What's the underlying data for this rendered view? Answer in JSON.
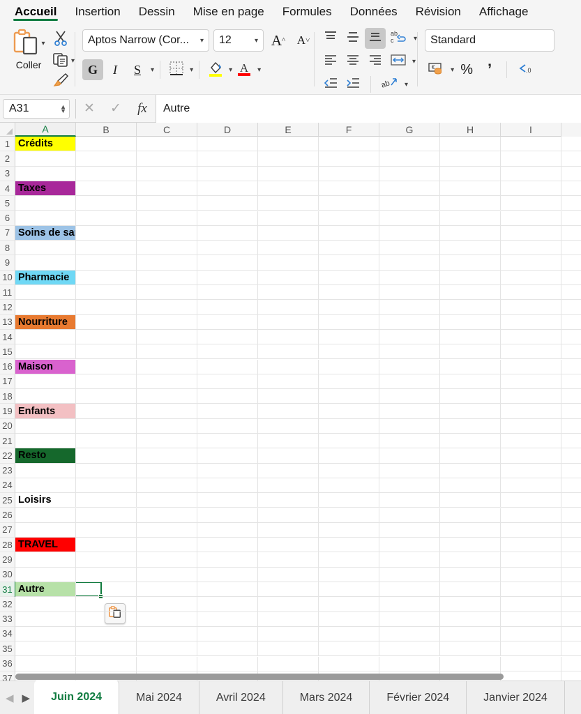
{
  "ribbon": {
    "tabs": [
      {
        "label": "Accueil",
        "active": true
      },
      {
        "label": "Insertion",
        "active": false
      },
      {
        "label": "Dessin",
        "active": false
      },
      {
        "label": "Mise en page",
        "active": false
      },
      {
        "label": "Formules",
        "active": false
      },
      {
        "label": "Données",
        "active": false
      },
      {
        "label": "Révision",
        "active": false
      },
      {
        "label": "Affichage",
        "active": false
      }
    ],
    "clipboard": {
      "paste_label": "Coller",
      "paste_icon": "clipboard-icon",
      "cut_icon": "scissors-icon",
      "copy_icon": "copy-icon",
      "format_painter_icon": "format-painter-icon"
    },
    "font": {
      "name": "Aptos Narrow (Cor...",
      "size": "12",
      "grow_label": "A",
      "shrink_label": "A",
      "bold_label": "G",
      "italic_label": "I",
      "underline_label": "S",
      "borders_icon": "borders-icon",
      "fill_color_icon": "fill-color-icon",
      "font_color_icon": "font-color-icon",
      "fill_color": "#FFFF00",
      "font_color": "#FF0000"
    },
    "alignment": {
      "align_top_icon": "align-top-icon",
      "align_middle_icon": "align-middle-icon",
      "align_bottom_icon": "align-bottom-icon",
      "wrap_text_icon": "wrap-text-icon",
      "align_left_icon": "align-left-icon",
      "align_center_icon": "align-center-icon",
      "align_right_icon": "align-right-icon",
      "merge_cells_icon": "merge-cells-icon",
      "decrease_indent_icon": "decrease-indent-icon",
      "increase_indent_icon": "increase-indent-icon",
      "orientation_icon": "text-orientation-icon"
    },
    "number": {
      "format": "Standard",
      "currency_icon": "currency-icon",
      "percent_label": "%",
      "comma_label": "’",
      "decimal_icon": "decrease-decimal-icon"
    },
    "accent_color": "#107c41"
  },
  "formula_bar": {
    "name_box": "A31",
    "cancel_icon": "cancel-icon",
    "confirm_icon": "confirm-icon",
    "fx_label": "fx",
    "content": "Autre"
  },
  "grid": {
    "columns": [
      "A",
      "B",
      "C",
      "D",
      "E",
      "F",
      "G",
      "H",
      "I"
    ],
    "selected_column": "A",
    "selected_cell": "A31",
    "row_count": 37,
    "rows": [
      {
        "n": 1,
        "value": "Crédits",
        "fill": "#FFFF00"
      },
      {
        "n": 2,
        "value": "",
        "fill": ""
      },
      {
        "n": 3,
        "value": "",
        "fill": ""
      },
      {
        "n": 4,
        "value": "Taxes",
        "fill": "#A8289A"
      },
      {
        "n": 5,
        "value": "",
        "fill": ""
      },
      {
        "n": 6,
        "value": "",
        "fill": ""
      },
      {
        "n": 7,
        "value": "Soins de santé",
        "fill": "#9DC3E6"
      },
      {
        "n": 8,
        "value": "",
        "fill": ""
      },
      {
        "n": 9,
        "value": "",
        "fill": ""
      },
      {
        "n": 10,
        "value": "Pharmacie",
        "fill": "#6FD8F5"
      },
      {
        "n": 11,
        "value": "",
        "fill": ""
      },
      {
        "n": 12,
        "value": "",
        "fill": ""
      },
      {
        "n": 13,
        "value": "Nourriture",
        "fill": "#E87A30"
      },
      {
        "n": 14,
        "value": "",
        "fill": ""
      },
      {
        "n": 15,
        "value": "",
        "fill": ""
      },
      {
        "n": 16,
        "value": "Maison",
        "fill": "#D962CE"
      },
      {
        "n": 17,
        "value": "",
        "fill": ""
      },
      {
        "n": 18,
        "value": "",
        "fill": ""
      },
      {
        "n": 19,
        "value": "Enfants",
        "fill": "#F3C0C3"
      },
      {
        "n": 20,
        "value": "",
        "fill": ""
      },
      {
        "n": 21,
        "value": "",
        "fill": ""
      },
      {
        "n": 22,
        "value": "Resto",
        "fill": "#15682C"
      },
      {
        "n": 23,
        "value": "",
        "fill": ""
      },
      {
        "n": 24,
        "value": "",
        "fill": ""
      },
      {
        "n": 25,
        "value": "Loisirs",
        "fill": ""
      },
      {
        "n": 26,
        "value": "",
        "fill": ""
      },
      {
        "n": 27,
        "value": "",
        "fill": ""
      },
      {
        "n": 28,
        "value": "TRAVEL",
        "fill": "#FF0000"
      },
      {
        "n": 29,
        "value": "",
        "fill": ""
      },
      {
        "n": 30,
        "value": "",
        "fill": ""
      },
      {
        "n": 31,
        "value": "Autre",
        "fill": "#B7E1A8"
      },
      {
        "n": 32,
        "value": "",
        "fill": ""
      },
      {
        "n": 33,
        "value": "",
        "fill": ""
      },
      {
        "n": 34,
        "value": "",
        "fill": ""
      },
      {
        "n": 35,
        "value": "",
        "fill": ""
      },
      {
        "n": 36,
        "value": "",
        "fill": ""
      },
      {
        "n": 37,
        "value": "",
        "fill": ""
      }
    ],
    "paste_options_icon": "paste-options-icon",
    "selection_color": "#0f7a3d"
  },
  "sheet_tabs": {
    "prev_icon": "prev-sheet-icon",
    "next_icon": "next-sheet-icon",
    "tabs": [
      {
        "label": "Juin 2024",
        "active": true
      },
      {
        "label": "Mai 2024",
        "active": false
      },
      {
        "label": "Avril 2024",
        "active": false
      },
      {
        "label": "Mars 2024",
        "active": false
      },
      {
        "label": "Février 2024",
        "active": false
      },
      {
        "label": "Janvier 2024",
        "active": false
      }
    ]
  }
}
